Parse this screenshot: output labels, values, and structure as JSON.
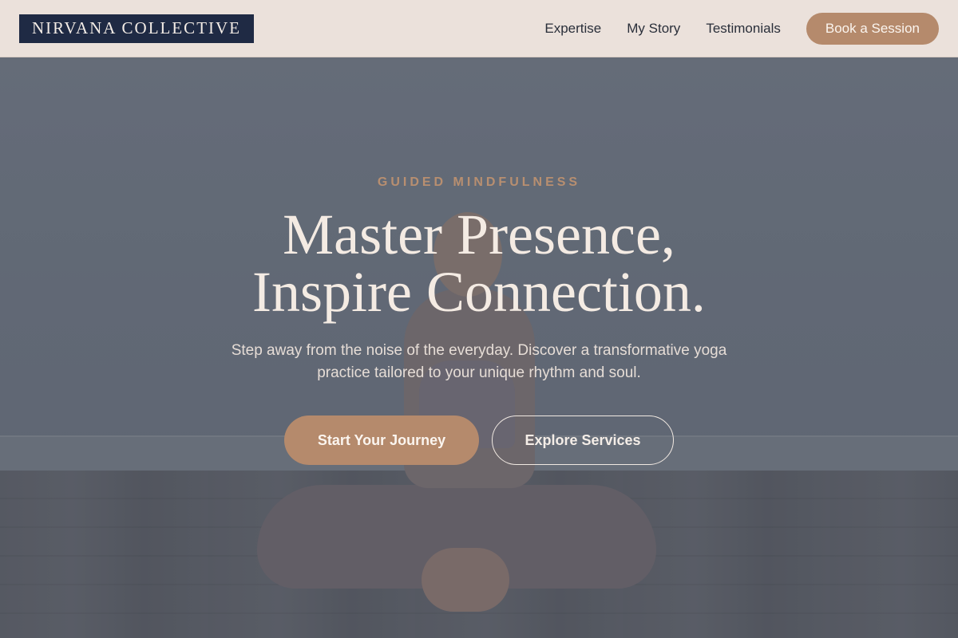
{
  "header": {
    "logo_text": "NIRVANA COLLECTIVE",
    "nav": [
      "Expertise",
      "My Story",
      "Testimonials"
    ],
    "cta_label": "Book a Session"
  },
  "hero": {
    "eyebrow": "GUIDED MINDFULNESS",
    "headline_line1": "Master Presence,",
    "headline_line2": "Inspire Connection.",
    "subtext": "Step away from the noise of the everyday. Discover a transformative yoga practice tailored to your unique rhythm and soul.",
    "primary_cta": "Start Your Journey",
    "secondary_cta": "Explore Services"
  },
  "colors": {
    "logo_bg": "#1f2a44",
    "header_bg": "#ebe1db",
    "accent": "#b58a6c",
    "eyebrow": "#b88f70",
    "headline": "#f4ebe3"
  }
}
